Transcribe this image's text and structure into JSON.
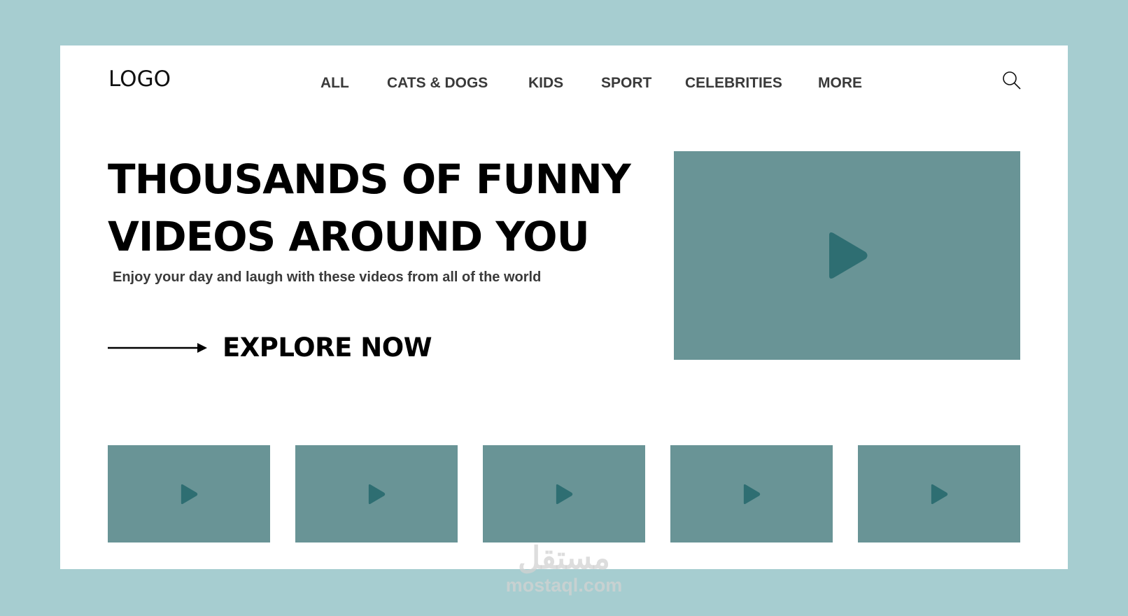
{
  "header": {
    "logo": "LOGO",
    "nav": [
      "ALL",
      "CATS & DOGS",
      "KIDS",
      "SPORT",
      "CELEBRITIES",
      "MORE"
    ],
    "search_icon": "search-icon"
  },
  "hero": {
    "title_line1": "THOUSANDS OF FUNNY",
    "title_line2": "VIDEOS AROUND YOU",
    "subtitle": "Enjoy your day and laugh with these videos from all of the world",
    "cta": "EXPLORE NOW"
  },
  "colors": {
    "background": "#a6cdd0",
    "video_placeholder": "#699496",
    "play_icon": "#2e6e72"
  },
  "thumbnails": 5,
  "watermark": {
    "arabic": "مستقل",
    "latin": "mostaql.com"
  }
}
